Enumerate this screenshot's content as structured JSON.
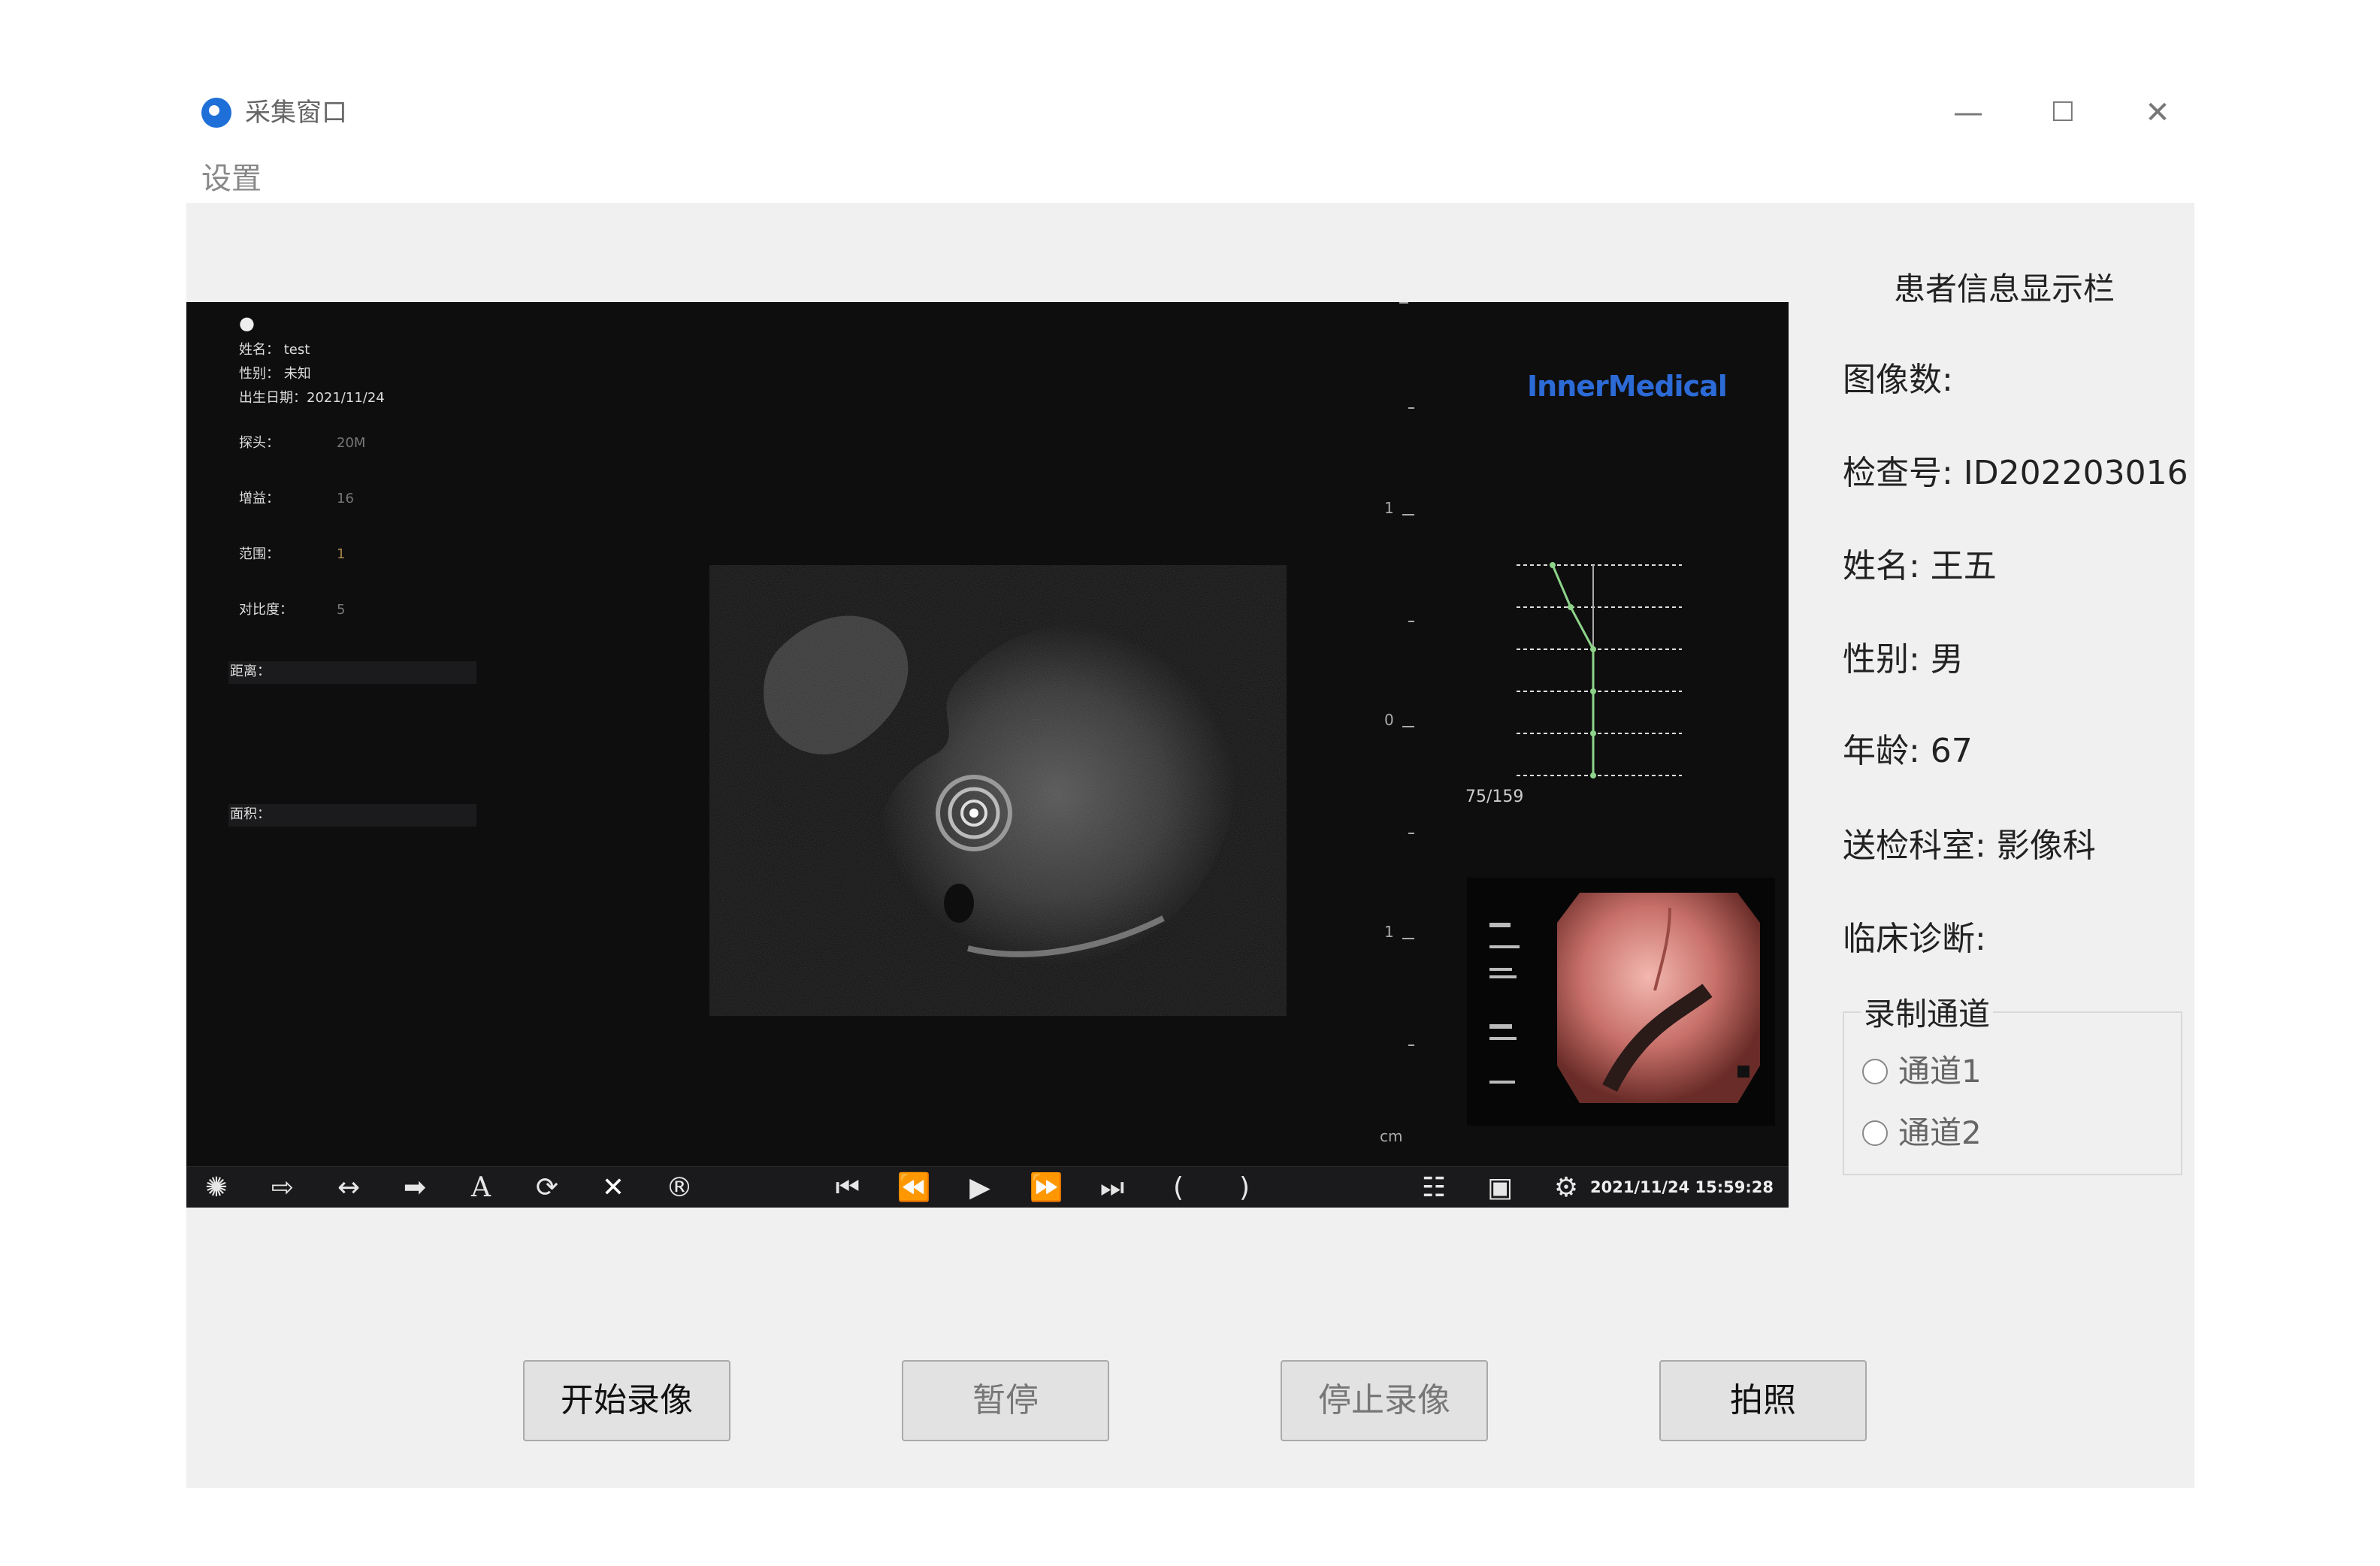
{
  "window": {
    "title": "采集窗口",
    "controls": {
      "minimize": "—",
      "maximize": "☐",
      "close": "✕"
    }
  },
  "menu": {
    "settings": "设置"
  },
  "viewer": {
    "patient": {
      "name": "姓名：  test",
      "gender": "性别：    未知",
      "birth": "出生日期：2021/11/24"
    },
    "params": [
      {
        "label": "探头：",
        "value": "20M"
      },
      {
        "label": "增益：",
        "value": "16"
      },
      {
        "label": "范围：",
        "value": "1"
      },
      {
        "label": "对比度：",
        "value": "5"
      }
    ],
    "distance_label": "距离：",
    "area_label": "面积：",
    "brand": "InnerMedical",
    "scale_labels": [
      "1",
      "0",
      "1"
    ],
    "scale_unit": "cm",
    "frame_counter": "75/159",
    "datetime": "2021/11/24 15:59:28",
    "toolbar_icons": [
      "settings-wheel-icon",
      "enter-icon",
      "measure-distance-icon",
      "arrow-right-icon",
      "text-icon",
      "rotate-icon",
      "delete-icon",
      "register-icon",
      "skip-start-icon",
      "rewind-icon",
      "play-icon",
      "fast-forward-icon",
      "skip-end-icon",
      "mark-in-icon",
      "mark-out-icon",
      "patient-info-icon",
      "save-disk-icon",
      "gear-icon"
    ]
  },
  "info_panel": {
    "title": "患者信息显示栏",
    "image_count": "图像数:",
    "exam_id": "检查号: ID202203016",
    "name": "姓名: 王五",
    "gender": "性别: 男",
    "age": "年龄: 67",
    "department": "送检科室: 影像科",
    "diagnosis": "临床诊断:",
    "channel_group": {
      "title": "录制通道",
      "options": [
        "通道1",
        "通道2"
      ],
      "selected": null
    }
  },
  "buttons": {
    "start": "开始录像",
    "pause": "暂停",
    "stop": "停止录像",
    "photo": "拍照"
  },
  "colors": {
    "accent": "#1e6fd8",
    "brand": "#2c6ad6",
    "panel_bg": "#f0f0f0",
    "viewer_bg": "#0e0e0f"
  }
}
